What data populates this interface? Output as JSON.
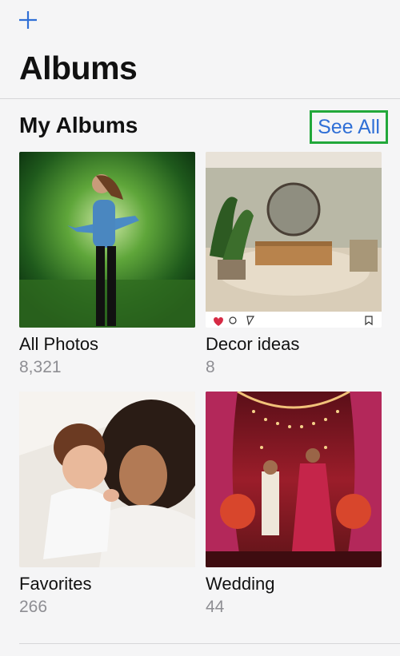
{
  "header": {
    "add_icon": "plus-icon",
    "title": "Albums"
  },
  "section": {
    "title": "My Albums",
    "see_all_label": "See All"
  },
  "albums": [
    {
      "name": "All Photos",
      "count": "8,321",
      "image": "woman-in-green-forest-tunnel"
    },
    {
      "name": "Decor ideas",
      "count": "8",
      "image": "living-room-decor"
    },
    {
      "name": "Favorites",
      "count": "266",
      "image": "mother-and-baby"
    },
    {
      "name": "Wedding",
      "count": "44",
      "image": "wedding-ceremony-red-drapes"
    }
  ],
  "colors": {
    "accent": "#2f6fd6",
    "highlight_box": "#22a83a",
    "count_gray": "#8e8e93",
    "background": "#f5f5f6"
  }
}
